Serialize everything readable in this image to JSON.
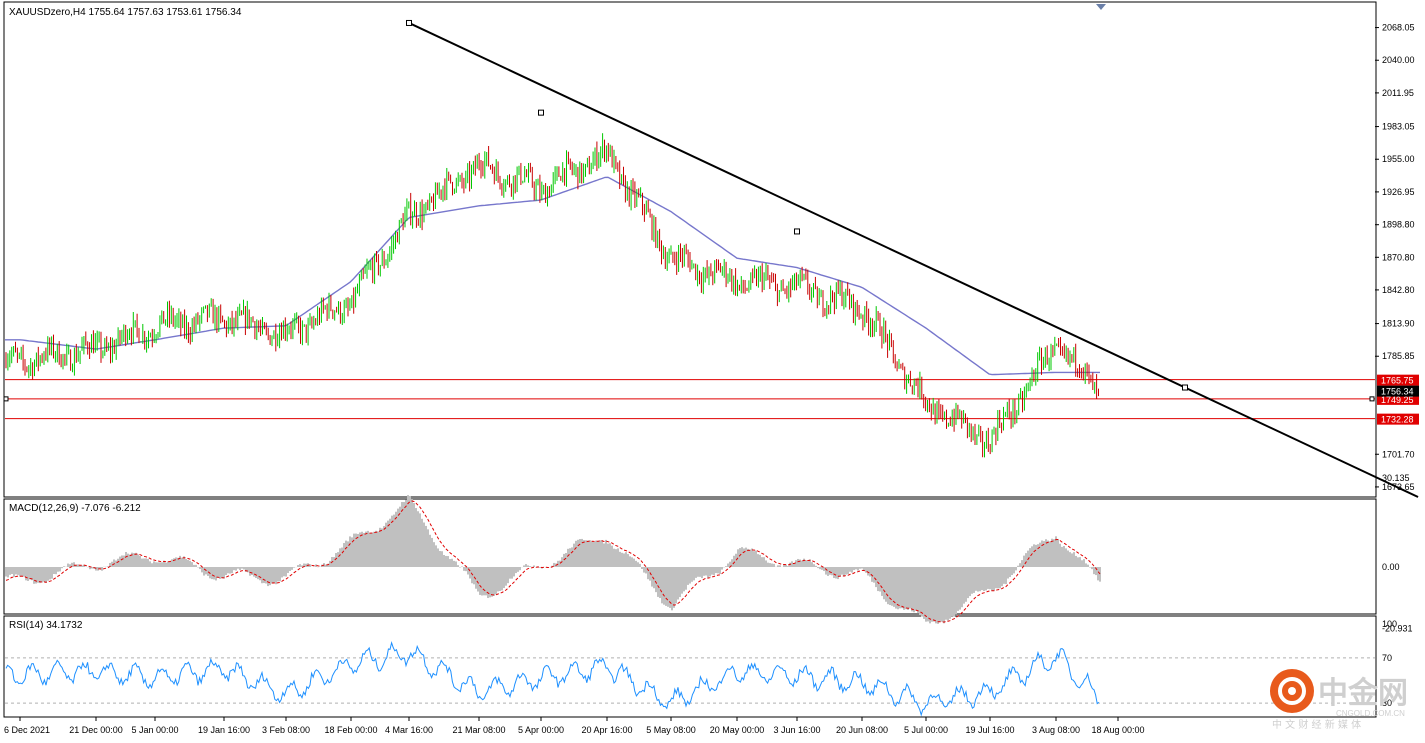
{
  "colors": {
    "background": "#ffffff",
    "frame": "#000000",
    "bull": "#00c800",
    "bear": "#c80000",
    "wick": "#000000",
    "ma": "#7777cc",
    "trendline": "#000000",
    "level": "#e00000",
    "level_label_bg": "#e00000",
    "price_label_bg": "#000000",
    "macd_hist": "#c0c0c0",
    "macd_signal": "#e00000",
    "rsi": "#1e90ff",
    "rsi_level": "#b0b0b0",
    "watermark": "#cfcfcf",
    "watermark_logo": "#e85a1c"
  },
  "header": {
    "symbol_info": "XAUUSDzero,H4  1755.64 1757.63 1753.61 1756.34"
  },
  "price_axis": {
    "ticks": [
      "2068.05",
      "2040.00",
      "2011.95",
      "1983.05",
      "1955.00",
      "1926.95",
      "1898.80",
      "1870.80",
      "1842.80",
      "1813.90",
      "1785.85",
      "1701.70",
      "1673.65"
    ],
    "tick_values": [
      2068.05,
      2040.0,
      2011.95,
      1983.05,
      1955.0,
      1926.95,
      1898.8,
      1870.8,
      1842.8,
      1813.9,
      1785.85,
      1701.7,
      1673.65
    ],
    "current_price": "1756.34",
    "current_value": 1756.34
  },
  "levels": [
    {
      "label": "1765.75",
      "value": 1765.75
    },
    {
      "label": "1749.25",
      "value": 1749.25
    },
    {
      "label": "1732.28",
      "value": 1732.28
    }
  ],
  "time_axis": {
    "labels": [
      "6 Dec 2021",
      "21 Dec 00:00",
      "5 Jan 00:00",
      "19 Jan 16:00",
      "3 Feb 08:00",
      "18 Feb 00:00",
      "4 Mar 16:00",
      "21 Mar 08:00",
      "5 Apr 00:00",
      "20 Apr 16:00",
      "5 May 08:00",
      "20 May 00:00",
      "3 Jun 16:00",
      "20 Jun 08:00",
      "5 Jul 00:00",
      "19 Jul 16:00",
      "3 Aug 08:00",
      "18 Aug 00:00"
    ]
  },
  "macd": {
    "label": "MACD(12,26,9) -7.076 -6.212",
    "ticks": [
      "30.135",
      "0.00",
      "-20.931"
    ],
    "tick_values": [
      30.135,
      0.0,
      -20.931
    ]
  },
  "rsi": {
    "label": "RSI(14) 34.1732",
    "ticks": [
      "100",
      "70",
      "30"
    ],
    "tick_values": [
      100,
      70,
      30
    ]
  },
  "watermark": {
    "title": "中金网",
    "subtitle": "中 文 财 经 新 媒 体",
    "domain": "CNGOLD.COM.CN"
  },
  "chart_data": {
    "type": "line",
    "title": "XAUUSDzero,H4",
    "xlabel": "",
    "ylabel": "",
    "ylim": [
      1665,
      2090
    ],
    "grid": false,
    "x": [
      "6 Dec 2021",
      "21 Dec 00:00",
      "5 Jan 00:00",
      "19 Jan 16:00",
      "3 Feb 08:00",
      "18 Feb 00:00",
      "4 Mar 16:00",
      "21 Mar 08:00",
      "5 Apr 00:00",
      "20 Apr 16:00",
      "5 May 08:00",
      "20 May 00:00",
      "3 Jun 16:00",
      "20 Jun 08:00",
      "5 Jul 00:00",
      "19 Jul 16:00",
      "3 Aug 08:00",
      "18 Aug 00:00"
    ],
    "series": [
      {
        "values": [
          1782,
          1792,
          1812,
          1818,
          1805,
          1832,
          1905,
          1950,
          1930,
          1960,
          1870,
          1850,
          1845,
          1828,
          1745,
          1712,
          1795,
          1756
        ]
      },
      {
        "values": [
          1800,
          1792,
          1800,
          1810,
          1812,
          1850,
          1905,
          1915,
          1920,
          1940,
          1910,
          1870,
          1862,
          1845,
          1810,
          1770,
          1772,
          1772
        ]
      }
    ],
    "trendline": {
      "points": [
        {
          "x": "4 Mar 16:00",
          "y": 2072
        },
        {
          "x": "5 Apr 00:00",
          "y": 1995
        },
        {
          "x": "3 Jun 16:00",
          "y": 1893
        },
        {
          "x": "18 Aug 00:00",
          "y": 1759
        }
      ]
    },
    "macd": [
      -5,
      1,
      4,
      -3,
      -4,
      8,
      22,
      -10,
      1,
      11,
      -13,
      5,
      1,
      -3,
      -20,
      -8,
      12,
      -6.212
    ],
    "rsi": [
      55,
      58,
      52,
      60,
      38,
      65,
      75,
      40,
      52,
      62,
      30,
      58,
      54,
      48,
      30,
      40,
      72,
      34.17
    ]
  }
}
